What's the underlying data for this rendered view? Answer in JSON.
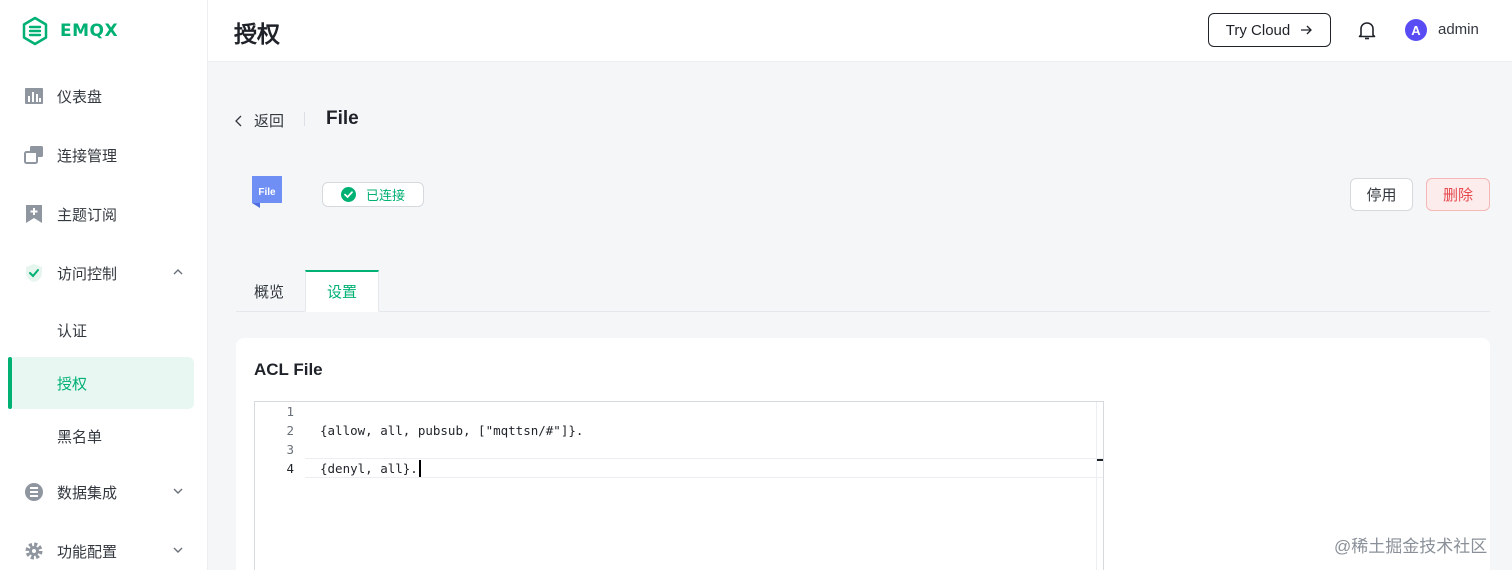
{
  "app": {
    "brand": "EMQX"
  },
  "sidebar": {
    "items": [
      {
        "label": "仪表盘",
        "icon": "dashboard-icon"
      },
      {
        "label": "连接管理",
        "icon": "connections-icon"
      },
      {
        "label": "主题订阅",
        "icon": "subscriptions-icon"
      },
      {
        "label": "访问控制",
        "icon": "access-control-icon",
        "expanded": true
      },
      {
        "label": "数据集成",
        "icon": "data-integration-icon"
      },
      {
        "label": "功能配置",
        "icon": "settings-icon"
      }
    ],
    "sub_items": [
      {
        "label": "认证"
      },
      {
        "label": "授权",
        "active": true
      },
      {
        "label": "黑名单"
      }
    ]
  },
  "header": {
    "title": "授权",
    "try_cloud_label": "Try Cloud",
    "avatar_letter": "A",
    "username": "admin"
  },
  "breadcrumb": {
    "back_label": "返回",
    "title": "File"
  },
  "source": {
    "logo_text": "File",
    "status": "已连接",
    "disable_label": "停用",
    "delete_label": "删除"
  },
  "tabs": [
    {
      "label": "概览",
      "active": false
    },
    {
      "label": "设置",
      "active": true
    }
  ],
  "acl": {
    "title": "ACL File",
    "lines": [
      {
        "num": "1",
        "text": ""
      },
      {
        "num": "2",
        "text": "{allow, all, pubsub, [\"mqttsn/#\"]}."
      },
      {
        "num": "3",
        "text": ""
      },
      {
        "num": "4",
        "text": "{denyl, all}."
      }
    ]
  },
  "watermark": "@稀土掘金技术社区",
  "colors": {
    "accent": "#00b173",
    "danger": "#e5484d",
    "avatar": "#5a4cf5",
    "file_logo": "#5b8def"
  }
}
